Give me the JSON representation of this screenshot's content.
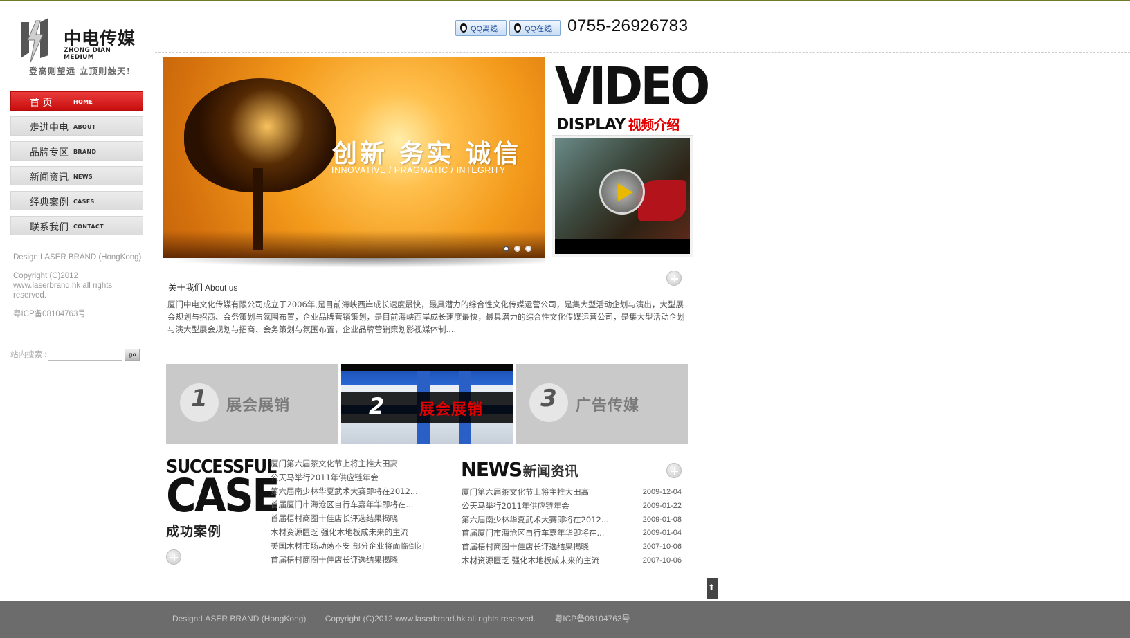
{
  "brand": {
    "name_cn": "中电传媒",
    "name_en": "ZHONG DIAN MEDIUM",
    "slogan": "登高则望远  立顶则触天!"
  },
  "nav": [
    {
      "cn": "首  页",
      "en": "HOME",
      "active": true
    },
    {
      "cn": "走进中电",
      "en": "ABOUT"
    },
    {
      "cn": "品牌专区",
      "en": "BRAND"
    },
    {
      "cn": "新闻资讯",
      "en": "NEWS"
    },
    {
      "cn": "经典案例",
      "en": "CASES"
    },
    {
      "cn": "联系我们",
      "en": "CONTACT"
    }
  ],
  "sidebar_credits": {
    "design": "Design:LASER BRAND (HongKong)",
    "copyright": " Copyright (C)2012 www.laserbrand.hk all rights reserved.",
    "icp": "粤ICP备08104763号"
  },
  "search": {
    "label": "站内搜索 :",
    "button": "go",
    "value": ""
  },
  "header": {
    "qq_offline": "QQ离线",
    "qq_online": "QQ在线",
    "phone": "0755-26926783"
  },
  "banner": {
    "title": "创新 务实 诚信",
    "subtitle": "INNOVATIVE / PRAGMATIC / INTEGRITY",
    "slide_count": 3,
    "active_slide": 1
  },
  "video": {
    "heading_big": "VIDEO",
    "heading_small": "DISPLAY",
    "heading_cn": "视频介绍"
  },
  "about": {
    "title_cn": "关于我们",
    "title_en": "About us",
    "body": "厦门中电文化传媒有限公司成立于2006年,是目前海峡西岸成长速度最快，最具潜力的综合性文化传媒运营公司，是集大型活动企划与演出，大型展会规划与招商、会务策划与氛围布置，企业品牌营销策划，是目前海峡西岸成长速度最快，最具潜力的综合性文化传媒运营公司，是集大型活动企划与演大型展会规划与招商、会务策划与氛围布置，企业品牌营销策划影视媒体制...."
  },
  "features": [
    {
      "num": "1",
      "label": "展会展销"
    },
    {
      "num": "2",
      "label": "展会展销"
    },
    {
      "num": "3",
      "label": "广告传媒"
    }
  ],
  "cases": {
    "heading_small": "SUCCESSFUL",
    "heading_big": "CASE",
    "heading_cn": "成功案例",
    "items": [
      "厦门第六届茶文化节上将主推大田高",
      "公天马举行2011年供应链年会",
      "第六届南少林华夏武术大赛即将在2012...",
      "首届厦门市海沧区自行车嘉年华即将在...",
      "首届梧村商圈十佳店长评选结果揭晓",
      "木材资源匮乏  强化木地板成未来的主流",
      "美国木材市场动荡不安  部分企业将面临倒闭",
      "首届梧村商圈十佳店长评选结果揭晓"
    ]
  },
  "news": {
    "heading_en": "NEWS",
    "heading_cn": "新闻资讯",
    "items": [
      {
        "title": "厦门第六届茶文化节上将主推大田高",
        "date": "2009-12-04"
      },
      {
        "title": "公天马举行2011年供应链年会",
        "date": "2009-01-22"
      },
      {
        "title": "第六届南少林华夏武术大赛即将在2012...",
        "date": "2009-01-08"
      },
      {
        "title": "首届厦门市海沧区自行车嘉年华即将在...",
        "date": "2009-01-04"
      },
      {
        "title": "首届梧村商圈十佳店长评选结果揭晓",
        "date": "2007-10-06"
      },
      {
        "title": "木材资源匮乏  强化木地板成未来的主流",
        "date": "2007-10-06"
      }
    ]
  },
  "footer": {
    "design": "Design:LASER BRAND (HongKong)",
    "copyright": "Copyright (C)2012 www.laserbrand.hk all rights reserved.",
    "icp": "粤ICP备08104763号"
  },
  "colors": {
    "accent_red": "#d01212",
    "footer_bg": "#6c6c6c",
    "top_line": "#6f7a2a"
  }
}
